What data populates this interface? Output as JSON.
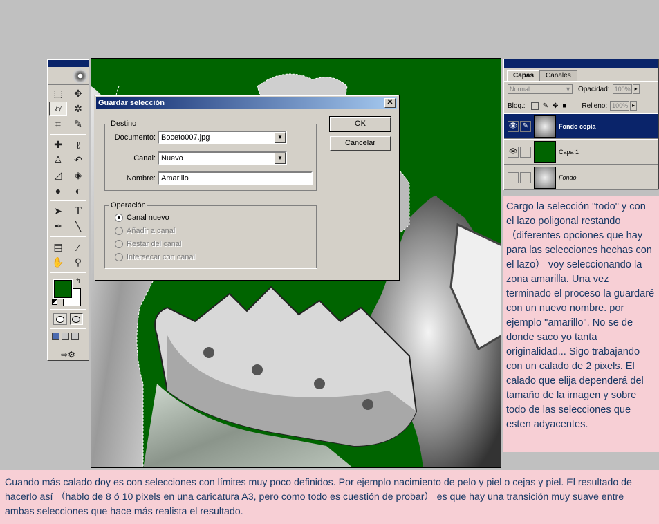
{
  "dialog": {
    "title": "Guardar selección",
    "close_glyph": "✕",
    "destino": {
      "legend": "Destino",
      "documento_label": "Documento:",
      "documento_value": "Boceto007.jpg",
      "canal_label": "Canal:",
      "canal_value": "Nuevo",
      "nombre_label": "Nombre:",
      "nombre_value": "Amarillo"
    },
    "operacion": {
      "legend": "Operación",
      "options": [
        {
          "label": "Canal nuevo",
          "selected": true,
          "enabled": true
        },
        {
          "label": "Añadir a canal",
          "selected": false,
          "enabled": false
        },
        {
          "label": "Restar del canal",
          "selected": false,
          "enabled": false
        },
        {
          "label": "Intersecar con canal",
          "selected": false,
          "enabled": false
        }
      ]
    },
    "ok_label": "OK",
    "cancel_label": "Cancelar"
  },
  "layers_panel": {
    "tabs": [
      "Capas",
      "Canales"
    ],
    "blend_mode": "Normal",
    "opacity_label": "Opacidad:",
    "opacity_value": "100%",
    "lock_label": "Bloq.:",
    "fill_label": "Relleno:",
    "fill_value": "100%",
    "layers": [
      {
        "name": "Fondo copia",
        "visible": true,
        "active": true
      },
      {
        "name": "Capa 1",
        "visible": true,
        "active": false
      },
      {
        "name": "Fondo",
        "visible": false,
        "active": false
      }
    ]
  },
  "toolbox": {
    "foreground_color": "#006400",
    "background_color": "#ffffff",
    "tools": [
      "marquee-icon",
      "move-icon",
      "polygonal-lasso-icon",
      "magic-wand-icon",
      "crop-icon",
      "slice-icon",
      "healing-brush-icon",
      "brush-icon",
      "clone-stamp-icon",
      "history-brush-icon",
      "eraser-icon",
      "paint-bucket-icon",
      "blur-icon",
      "dodge-icon",
      "path-select-icon",
      "type-icon",
      "pen-icon",
      "line-icon",
      "notes-icon",
      "eyedropper-icon",
      "hand-icon",
      "zoom-icon"
    ]
  },
  "side_note": "Cargo la selección \"todo\" y con el lazo poligonal restando （diferentes opciones que hay para las selecciones hechas con el lazo） voy seleccionando la zona amarilla. Una vez terminado el proceso la guardaré con un nuevo nombre. por ejemplo \"amarillo\". No se de donde saco yo tanta originalidad... Sigo trabajando con un calado de 2 pixels. El calado que elija dependerá del tamaño de la imagen y sobre todo de las selecciones que esten adyacentes.",
  "bottom_note": "Cuando más calado doy es con selecciones con límites muy poco definidos. Por ejemplo nacimiento de pelo y piel o cejas y piel. El resultado de hacerlo así （hablo de 8 ó 10 pixels en una caricatura A3, pero como todo es cuestión de probar） es que hay una transición muy suave entre ambas selecciones que hace más realista el resultado.",
  "colors": {
    "canvas_green": "#006400",
    "note_bg": "#f7cfd5",
    "note_text": "#1a3a66",
    "title_bar": "#0a246a"
  }
}
